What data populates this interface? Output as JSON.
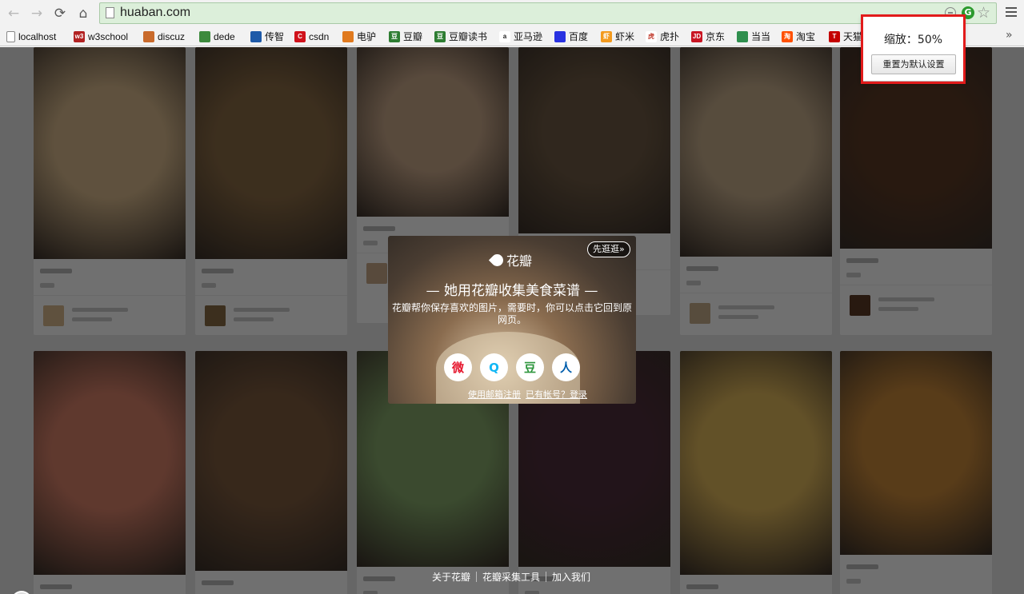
{
  "browser": {
    "url": "huaban.com",
    "bookmarks": [
      {
        "label": "localhost",
        "icon": "page-icon",
        "color": "#ffffff"
      },
      {
        "label": "w3school",
        "icon": "w3-icon",
        "color": "#b22222"
      },
      {
        "label": "discuz",
        "icon": "brick-icon",
        "color": "#c96a2b"
      },
      {
        "label": "dede",
        "icon": "dede-icon",
        "color": "#3d8a3d"
      },
      {
        "label": "传智",
        "icon": "chuanzhi-icon",
        "color": "#1e5aa8"
      },
      {
        "label": "csdn",
        "icon": "csdn-icon",
        "color": "#d0121b"
      },
      {
        "label": "电驴",
        "icon": "donkey-icon",
        "color": "#e07a1f"
      },
      {
        "label": "豆瓣",
        "icon": "douban-icon",
        "color": "#2e7d32"
      },
      {
        "label": "豆瓣读书",
        "icon": "douban-book-icon",
        "color": "#2e7d32"
      },
      {
        "label": "亚马逊",
        "icon": "amazon-icon",
        "color": "#222222"
      },
      {
        "label": "百度",
        "icon": "baidu-icon",
        "color": "#2932e1"
      },
      {
        "label": "虾米",
        "icon": "xiami-icon",
        "color": "#f39a1e"
      },
      {
        "label": "虎扑",
        "icon": "hupu-icon",
        "color": "#c0392b"
      },
      {
        "label": "京东",
        "icon": "jd-icon",
        "color": "#c91623"
      },
      {
        "label": "当当",
        "icon": "dangdang-icon",
        "color": "#2f8f4e"
      },
      {
        "label": "淘宝",
        "icon": "taobao-icon",
        "color": "#ff5000"
      },
      {
        "label": "天猫",
        "icon": "tmall-icon",
        "color": "#c40000"
      }
    ]
  },
  "zoom_popup": {
    "zoom_text": "缩放：50%",
    "reset_label": "重置为默认设置"
  },
  "modal": {
    "brand": "花瓣",
    "explore_label": "先逛逛»",
    "title": "— 她用花瓣收集美食菜谱 —",
    "description": "花瓣帮你保存喜欢的图片，需要时，你可以点击它回到原网页。",
    "social_buttons": [
      {
        "name": "weibo",
        "glyph": "微",
        "color": "#e6162d"
      },
      {
        "name": "qq",
        "glyph": "Q",
        "color": "#12b7f5"
      },
      {
        "name": "douban",
        "glyph": "豆",
        "color": "#2e963d"
      },
      {
        "name": "renren",
        "glyph": "人",
        "color": "#005eac"
      }
    ],
    "signup_label": "使用邮箱注册",
    "login_label": "已有帐号？登录"
  },
  "footer": {
    "links": [
      "关于花瓣",
      "花瓣采集工具",
      "加入我们"
    ]
  },
  "pins": [
    {
      "color": "#d8b98d"
    },
    {
      "color": "#8a6b45"
    },
    {
      "color": "#c9a88a"
    },
    {
      "color": "#6e5a44"
    },
    {
      "color": "#c6ad8c"
    },
    {
      "color": "#5c3a26"
    },
    {
      "color": "#d9826a"
    },
    {
      "color": "#7d5b3f"
    },
    {
      "color": "#86a96b"
    },
    {
      "color": "#4f2f3b"
    },
    {
      "color": "#e0b85c"
    },
    {
      "color": "#c8883a"
    }
  ]
}
